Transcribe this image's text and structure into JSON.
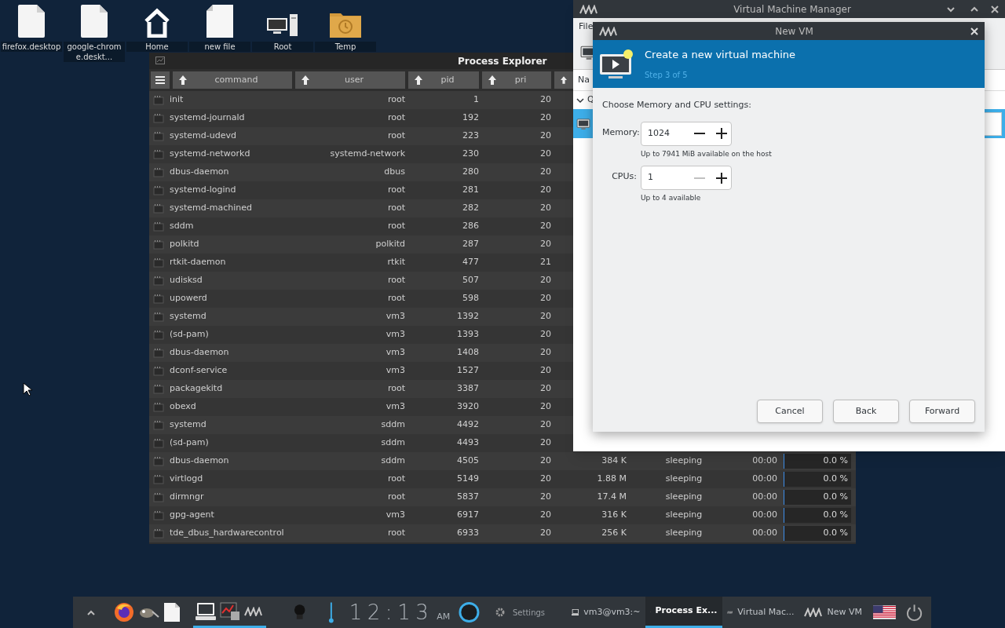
{
  "desktop_icons": [
    {
      "kind": "file",
      "label": "firefox.desktop"
    },
    {
      "kind": "file",
      "label": "google-chrome.deskt..."
    },
    {
      "kind": "home",
      "label": "Home"
    },
    {
      "kind": "new-file",
      "label": "new file"
    },
    {
      "kind": "computer",
      "label": "Root"
    },
    {
      "kind": "folder",
      "label": "Temp"
    }
  ],
  "process_explorer": {
    "title": "Process Explorer",
    "columns": [
      {
        "label": "command",
        "ascending": true
      },
      {
        "label": "user",
        "ascending": true
      },
      {
        "label": "pid",
        "ascending": true
      },
      {
        "label": "pri",
        "ascending": true
      },
      {
        "ascending": true
      }
    ],
    "rows": [
      {
        "command": "init",
        "user": "root",
        "pid": "1",
        "pri": "20"
      },
      {
        "command": "systemd-journald",
        "user": "root",
        "pid": "192",
        "pri": "20"
      },
      {
        "command": "systemd-udevd",
        "user": "root",
        "pid": "223",
        "pri": "20"
      },
      {
        "command": "systemd-networkd",
        "user": "systemd-network",
        "pid": "230",
        "pri": "20"
      },
      {
        "command": "dbus-daemon",
        "user": "dbus",
        "pid": "280",
        "pri": "20"
      },
      {
        "command": "systemd-logind",
        "user": "root",
        "pid": "281",
        "pri": "20"
      },
      {
        "command": "systemd-machined",
        "user": "root",
        "pid": "282",
        "pri": "20"
      },
      {
        "command": "sddm",
        "user": "root",
        "pid": "286",
        "pri": "20"
      },
      {
        "command": "polkitd",
        "user": "polkitd",
        "pid": "287",
        "pri": "20"
      },
      {
        "command": "rtkit-daemon",
        "user": "rtkit",
        "pid": "477",
        "pri": "21"
      },
      {
        "command": "udisksd",
        "user": "root",
        "pid": "507",
        "pri": "20"
      },
      {
        "command": "upowerd",
        "user": "root",
        "pid": "598",
        "pri": "20"
      },
      {
        "command": "systemd",
        "user": "vm3",
        "pid": "1392",
        "pri": "20"
      },
      {
        "command": "(sd-pam)",
        "user": "vm3",
        "pid": "1393",
        "pri": "20"
      },
      {
        "command": "dbus-daemon",
        "user": "vm3",
        "pid": "1408",
        "pri": "20"
      },
      {
        "command": "dconf-service",
        "user": "vm3",
        "pid": "1527",
        "pri": "20"
      },
      {
        "command": "packagekitd",
        "user": "root",
        "pid": "3387",
        "pri": "20"
      },
      {
        "command": "obexd",
        "user": "vm3",
        "pid": "3920",
        "pri": "20"
      },
      {
        "command": "systemd",
        "user": "sddm",
        "pid": "4492",
        "pri": "20"
      },
      {
        "command": "(sd-pam)",
        "user": "sddm",
        "pid": "4493",
        "pri": "20"
      },
      {
        "command": "dbus-daemon",
        "user": "sddm",
        "pid": "4505",
        "pri": "20",
        "mem": "384 K",
        "state": "sleeping",
        "time": "00:00",
        "cpu": "0.0 %",
        "level": 0
      },
      {
        "command": "virtlogd",
        "user": "root",
        "pid": "5149",
        "pri": "20",
        "mem": "1.88 M",
        "state": "sleeping",
        "time": "00:00",
        "cpu": "0.0 %",
        "level": 0
      },
      {
        "command": "dirmngr",
        "user": "root",
        "pid": "5837",
        "pri": "20",
        "mem": "17.4 M",
        "state": "sleeping",
        "time": "00:00",
        "cpu": "0.0 %",
        "level": 0
      },
      {
        "command": "gpg-agent",
        "user": "vm3",
        "pid": "6917",
        "pri": "20",
        "mem": "316 K",
        "state": "sleeping",
        "time": "00:00",
        "cpu": "0.0 %",
        "level": 0
      },
      {
        "command": "tde_dbus_hardwarecontrol",
        "user": "root",
        "pid": "6933",
        "pri": "20",
        "mem": "256 K",
        "state": "sleeping",
        "time": "00:00",
        "cpu": "0.0 %",
        "level": 0
      }
    ]
  },
  "vm_manager": {
    "title": "Virtual Machine Manager",
    "menu": [
      "File"
    ],
    "list_header": "Na",
    "group": {
      "label": "Q",
      "expanded": true
    },
    "vm_row": {
      "selected": true
    }
  },
  "new_vm_dialog": {
    "title": "New VM",
    "heading": "Create a new virtual machine",
    "step": "Step 3 of 5",
    "prompt": "Choose Memory and CPU settings:",
    "fields": [
      {
        "label": "Memory:",
        "value": "1024",
        "hint": "Up to 7941 MiB available on the host",
        "decrement_disabled": false
      },
      {
        "label": "CPUs:",
        "value": "1",
        "hint": "Up to 4 available",
        "decrement_disabled": true
      }
    ],
    "buttons": [
      "Cancel",
      "Back",
      "Forward"
    ]
  },
  "taskbar": {
    "launchers": [
      {
        "kind": "firefox",
        "running": false
      },
      {
        "kind": "gimp",
        "running": false
      },
      {
        "kind": "file",
        "running": false
      },
      {
        "kind": "terminal",
        "running": true
      },
      {
        "kind": "process-explorer",
        "running": true
      },
      {
        "kind": "virt-manager",
        "running": true
      }
    ],
    "clock": {
      "time": "12:13",
      "period": "AM"
    },
    "settings": "Settings",
    "tasks": [
      {
        "kind": "terminal",
        "label": "vm3@vm3:~",
        "selected": false
      },
      {
        "kind": "process-explorer",
        "label": "Process Ex...",
        "selected": true
      },
      {
        "kind": "virt-manager",
        "label": "Virtual Mac...",
        "selected": false
      },
      {
        "kind": "virt-manager",
        "label": "New VM",
        "selected": false
      }
    ]
  }
}
